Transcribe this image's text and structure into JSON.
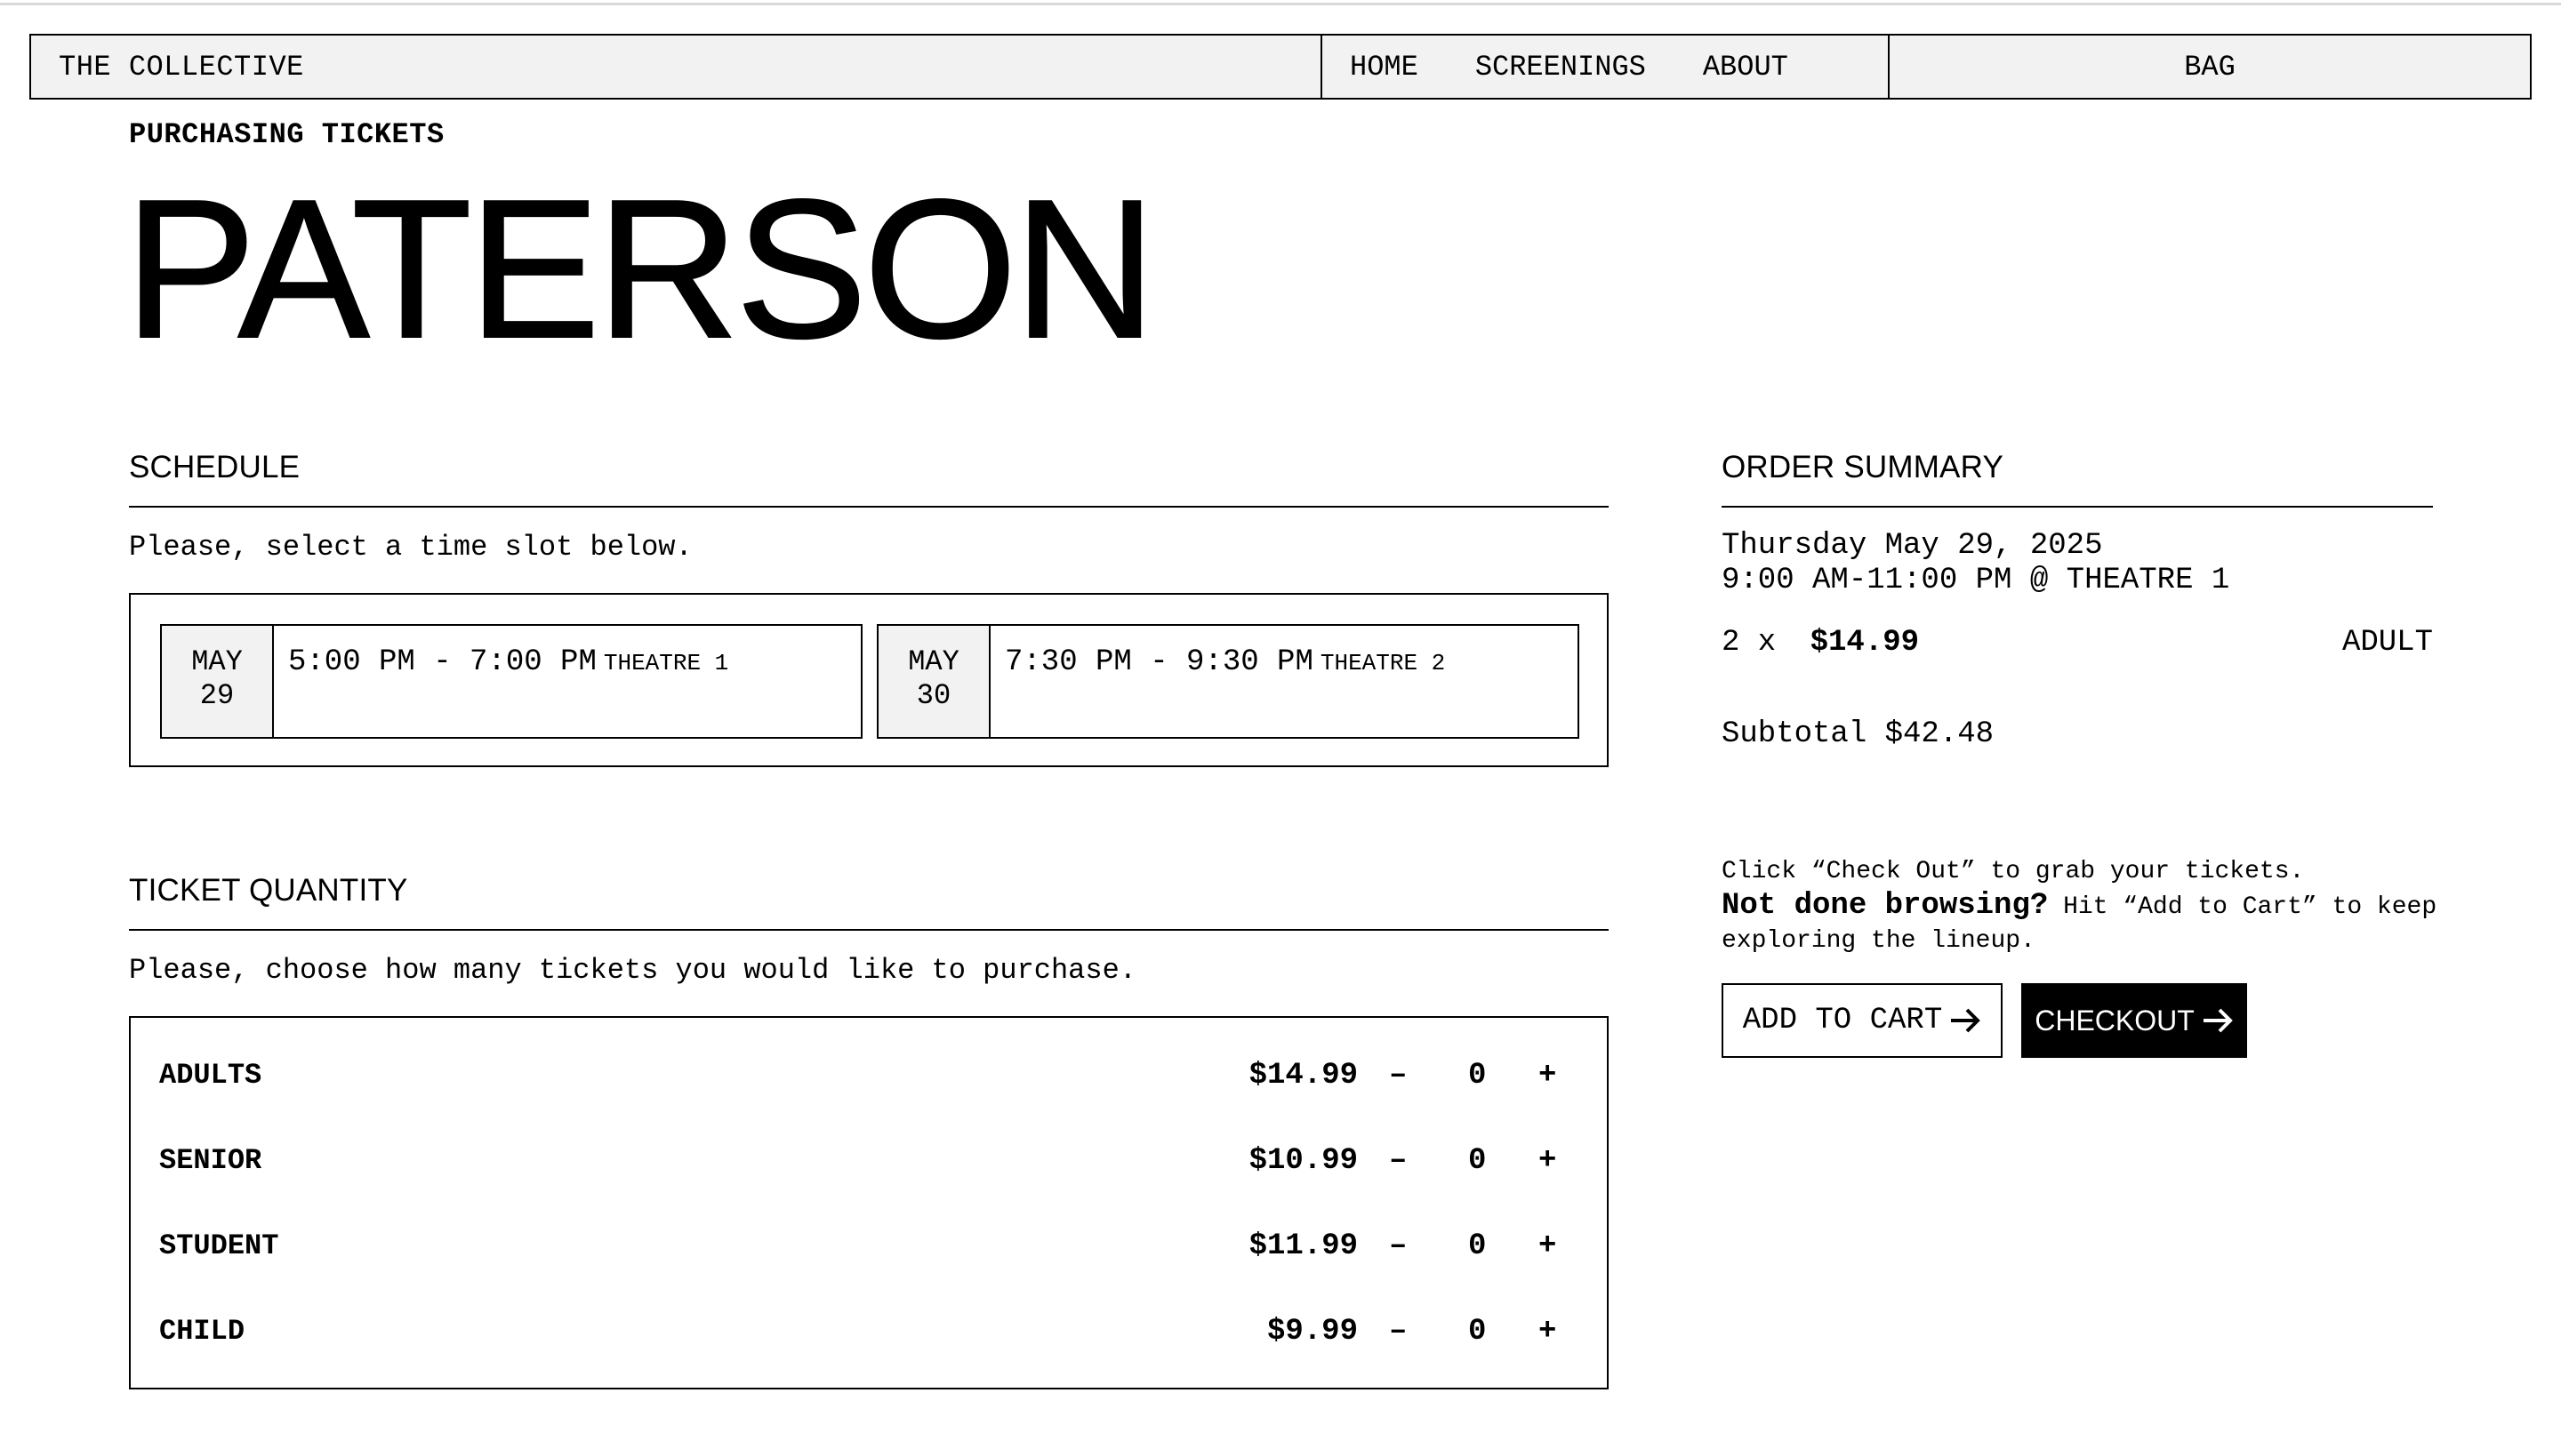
{
  "nav": {
    "brand": "THE COLLECTIVE",
    "links": [
      "HOME",
      "SCREENINGS",
      "ABOUT"
    ],
    "bag": "BAG"
  },
  "page": {
    "breadcrumb": "PURCHASING TICKETS",
    "title": "PATERSON"
  },
  "schedule": {
    "heading": "SCHEDULE",
    "help": "Please, select a time slot below.",
    "slots": [
      {
        "month": "MAY",
        "day": "29",
        "time": "5:00 PM - 7:00 PM",
        "theatre": "THEATRE 1"
      },
      {
        "month": "MAY",
        "day": "30",
        "time": "7:30 PM - 9:30 PM",
        "theatre": "THEATRE 2"
      }
    ]
  },
  "tickets": {
    "heading": "TICKET QUANTITY",
    "help": "Please, choose how many tickets you would like to purchase.",
    "minus": "–",
    "plus": "+",
    "rows": [
      {
        "name": "ADULTS",
        "price": "$14.99",
        "qty": "0"
      },
      {
        "name": "SENIOR",
        "price": "$10.99",
        "qty": "0"
      },
      {
        "name": "STUDENT",
        "price": "$11.99",
        "qty": "0"
      },
      {
        "name": "CHILD",
        "price": "$9.99",
        "qty": "0"
      }
    ]
  },
  "summary": {
    "heading": "ORDER SUMMARY",
    "date": "Thursday May 29, 2025",
    "slot": "9:00 AM-11:00 PM @ THEATRE 1",
    "line_qty": "2 x",
    "line_price": "$14.99",
    "line_type": "ADULT",
    "subtotal": "Subtotal $42.48",
    "note_line1": "Click “Check Out” to grab your tickets.",
    "note_bold": "Not done browsing?",
    "note_rest": " Hit “Add to Cart” to keep exploring the lineup.",
    "add_to_cart": "ADD TO CART",
    "checkout": "CHECKOUT"
  }
}
